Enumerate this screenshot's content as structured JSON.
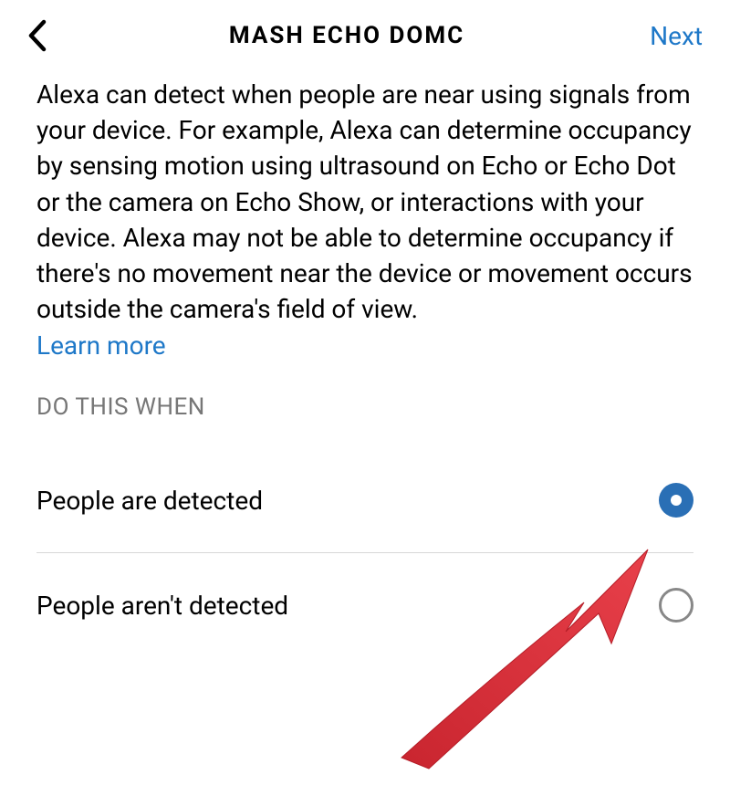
{
  "header": {
    "title": "MASH ECHO DOMC",
    "next_label": "Next"
  },
  "content": {
    "description": "Alexa can detect when people are near using signals from your device. For example, Alexa can determine occupancy by sensing motion using ultrasound on Echo or Echo Dot or the camera on Echo Show, or interactions with your device. Alexa may not be able to determine occupancy if there's no movement near the device or movement occurs outside the camera's field of view.",
    "learn_more_label": "Learn more",
    "section_label": "DO THIS WHEN"
  },
  "options": [
    {
      "label": "People are detected",
      "selected": true
    },
    {
      "label": "People aren't detected",
      "selected": false
    }
  ],
  "colors": {
    "link": "#1e78c8",
    "radio_selected": "#2a6fb5",
    "arrow": "#d7303b"
  }
}
